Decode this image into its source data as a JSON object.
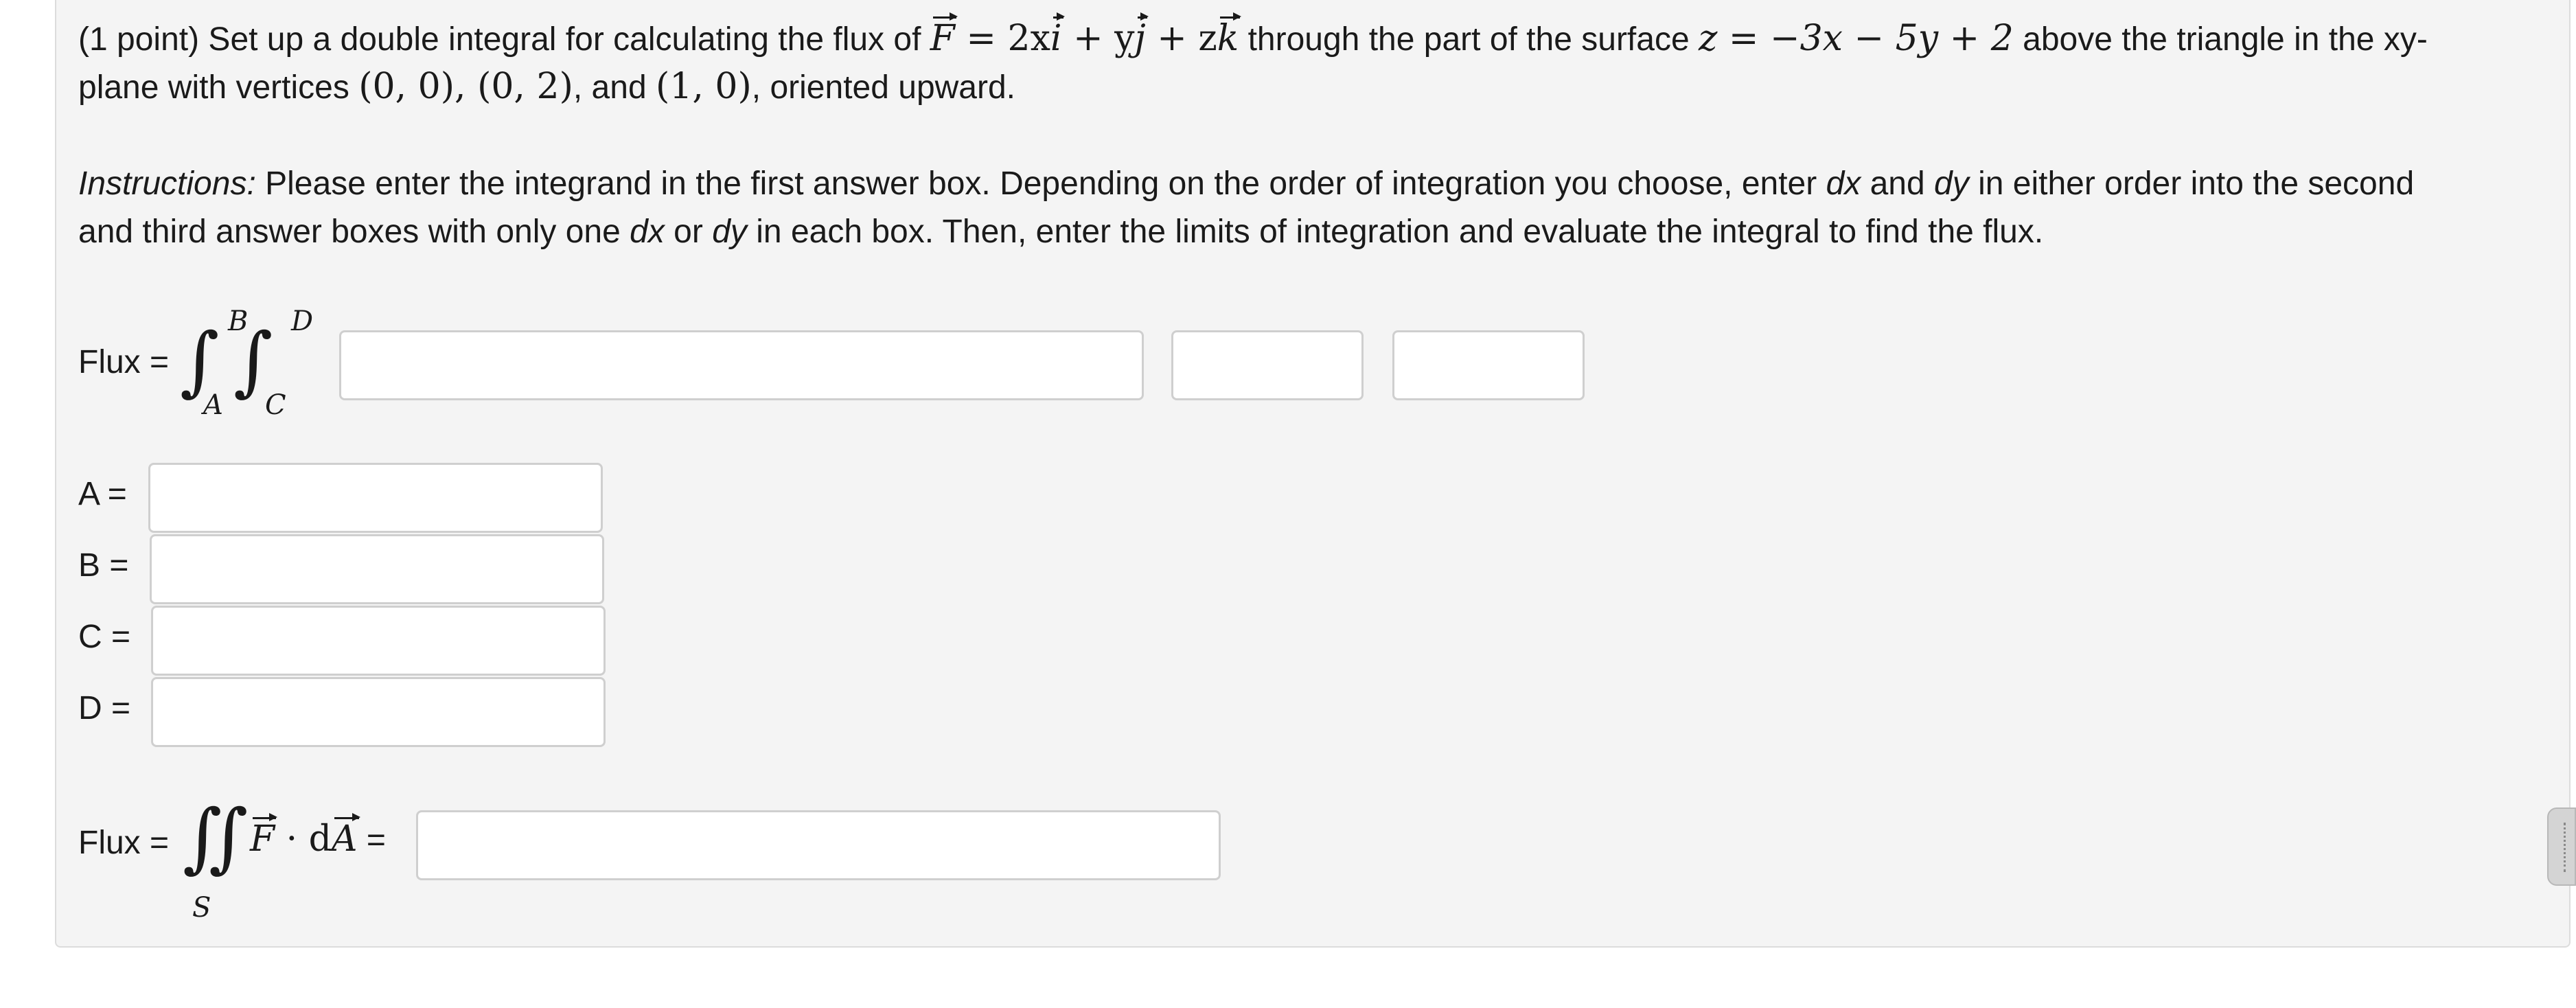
{
  "problem": {
    "line1_prefix": "(1 point) Set up a double integral for calculating the flux of ",
    "field_lhs": "F",
    "field_eq": " = 2x",
    "unit_i": "i",
    "plus_y": " + y",
    "unit_j": "j",
    "plus_z": " + z",
    "unit_k": "k",
    "line1_mid": " through the part of the surface ",
    "surface_eq": "z = −3x − 5y + 2",
    "line1_suffix": " above the triangle in the xy-",
    "line2_prefix": "plane with vertices ",
    "vertex1": "(0, 0)",
    "comma1": ", ",
    "vertex2": "(0, 2)",
    "and_text": ", and ",
    "vertex3": "(1, 0)",
    "line2_suffix": ", oriented upward."
  },
  "instructions": {
    "label": "Instructions:",
    "line1_a": " Please enter the integrand in the first answer box. Depending on the order of integration you choose, enter ",
    "dx1": "dx",
    "and1": " and ",
    "dy1": "dy",
    "line1_b": " in either order into the second",
    "line2_a": "and third answer boxes with only one ",
    "dx2": "dx",
    "or_text": " or ",
    "dy2": "dy",
    "line2_b": " in each box. Then, enter the limits of integration and evaluate the integral to find the flux."
  },
  "integral": {
    "flux_label": "Flux =",
    "upper_outer": "B",
    "lower_outer": "A",
    "upper_inner": "D",
    "lower_inner": "C",
    "integrand_value": "",
    "differential1_value": "",
    "differential2_value": ""
  },
  "limits": [
    {
      "label": "A =",
      "value": ""
    },
    {
      "label": "B =",
      "value": ""
    },
    {
      "label": "C =",
      "value": ""
    },
    {
      "label": "D =",
      "value": ""
    }
  ],
  "flux_result": {
    "label": "Flux =",
    "surface_sub": "S",
    "integrand_F": "F",
    "dot": " · d",
    "integrand_A": "A",
    "equals": " =",
    "value": ""
  },
  "icons": {
    "scroll_handle": "drag-handle-icon"
  }
}
